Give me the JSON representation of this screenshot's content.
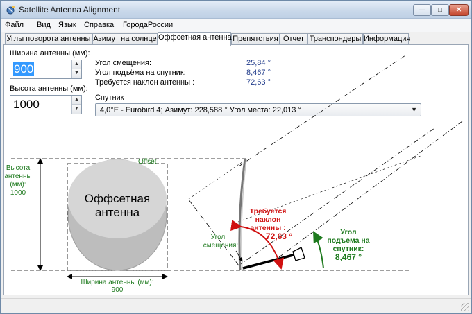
{
  "window": {
    "title": "Satellite Antenna Alignment"
  },
  "menu": [
    "Файл",
    "Вид",
    "Язык",
    "Справка",
    "ГородаРоссии"
  ],
  "tabs": [
    "Углы поворота антенны",
    "Азимут на солнце",
    "Оффсетная антенна",
    "Препятствия",
    "Отчет",
    "Транспондеры",
    "Информация"
  ],
  "active_tab": "Оффсетная антенна",
  "inputs": {
    "width_label": "Ширина антенны (мм):",
    "width_value": "900",
    "height_label": "Высота антенны (мм):",
    "height_value": "1000"
  },
  "results": {
    "offset_angle_label": "Угол смещения:",
    "offset_angle_value": "25,84 °",
    "elevation_label": "Угол подъёма на спутник:",
    "elevation_value": "8,467 °",
    "tilt_label": "Требуется наклон антенны :",
    "tilt_value": "72,63 °"
  },
  "satellite": {
    "label": "Спутник",
    "selected": "4,0°E - Eurobird 4;  Азимут: 228,588 °  Угол места: 22,013 °"
  },
  "diagram": {
    "dish_title_line1": "Оффсетная",
    "dish_title_line2": "антенна",
    "offset_label": "Offset",
    "height_line1": "Высота",
    "height_line2": "антенны",
    "height_line3": "(мм):",
    "height_line4": "1000",
    "width_line1": "Ширина антенны (мм):",
    "width_line2": "900",
    "offset_angle_line1": "Угол",
    "offset_angle_line2": "смещения:",
    "tilt_line1": "Требуется",
    "tilt_line2": "наклон",
    "tilt_line3": "антенны :",
    "tilt_line4": "72,63 °",
    "elev_line1": "Угол",
    "elev_line2": "подъёма на",
    "elev_line3": "спутник:",
    "elev_line4": "8,467 °"
  },
  "colors": {
    "green": "#1e7a1e",
    "red": "#d01010",
    "value_blue": "#1f3a8a",
    "selection": "#3399ff",
    "dish_outer": "#bdbdbd",
    "dish_inner": "#d6d6d6"
  },
  "icons": [
    "satellite-app-icon",
    "minimize-icon",
    "maximize-icon",
    "close-icon",
    "spin-up-icon",
    "spin-down-icon",
    "dropdown-arrow-icon",
    "size-grip-icon"
  ]
}
